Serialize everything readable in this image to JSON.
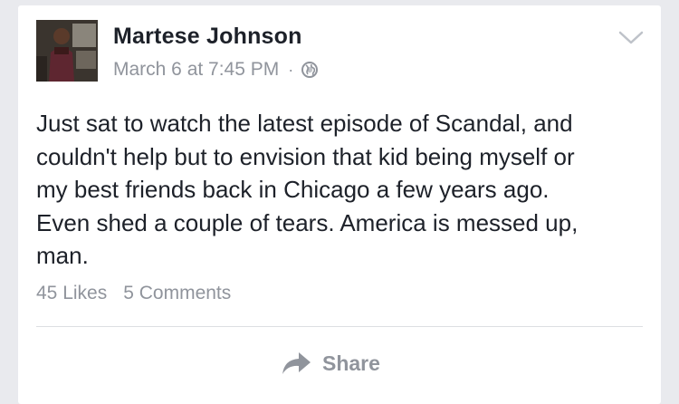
{
  "post": {
    "author": "Martese Johnson",
    "timestamp": "March 6 at 7:45 PM",
    "separator": "·",
    "privacy_icon": "globe-icon",
    "menu_icon": "chevron-down-icon",
    "text_lines": [
      "Just sat to watch the latest episode of Scandal, and",
      "couldn't help but to envision that kid being myself or",
      "my best friends back in Chicago a few years ago.",
      "Even shed a couple of tears. America is messed up,",
      "man."
    ],
    "likes": "45 Likes",
    "comments": "5 Comments"
  },
  "actions": {
    "share_label": "Share",
    "share_icon": "share-arrow-icon"
  },
  "colors": {
    "background": "#e9eaee",
    "card": "#ffffff",
    "text": "#1d2129",
    "muted": "#90949c"
  }
}
